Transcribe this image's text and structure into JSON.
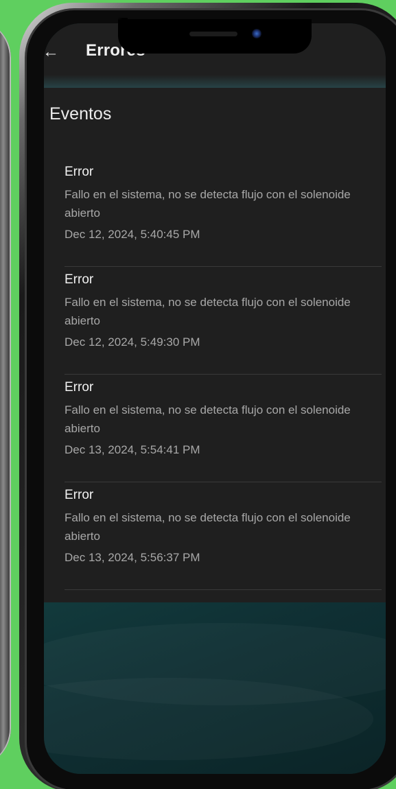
{
  "appbar": {
    "back_icon": "arrow-left-icon",
    "title": "Errores"
  },
  "section": {
    "title": "Eventos"
  },
  "events": [
    {
      "type": "Error",
      "description": "Fallo en el sistema, no se detecta flujo con el solenoide abierto",
      "timestamp": "Dec 12, 2024, 5:40:45 PM"
    },
    {
      "type": "Error",
      "description": "Fallo en el sistema, no se detecta flujo con el solenoide abierto",
      "timestamp": "Dec 12, 2024, 5:49:30 PM"
    },
    {
      "type": "Error",
      "description": "Fallo en el sistema, no se detecta flujo con el solenoide abierto",
      "timestamp": "Dec 13, 2024, 5:54:41 PM"
    },
    {
      "type": "Error",
      "description": "Fallo en el sistema, no se detecta flujo con el solenoide abierto",
      "timestamp": "Dec 13, 2024, 5:56:37 PM"
    }
  ],
  "colors": {
    "background_green": "#5fcf5f",
    "surface": "#1f1f1f",
    "text_primary": "#f2f2f2",
    "text_secondary": "#a8a8a8",
    "teal_background": "#0f2a2d"
  }
}
